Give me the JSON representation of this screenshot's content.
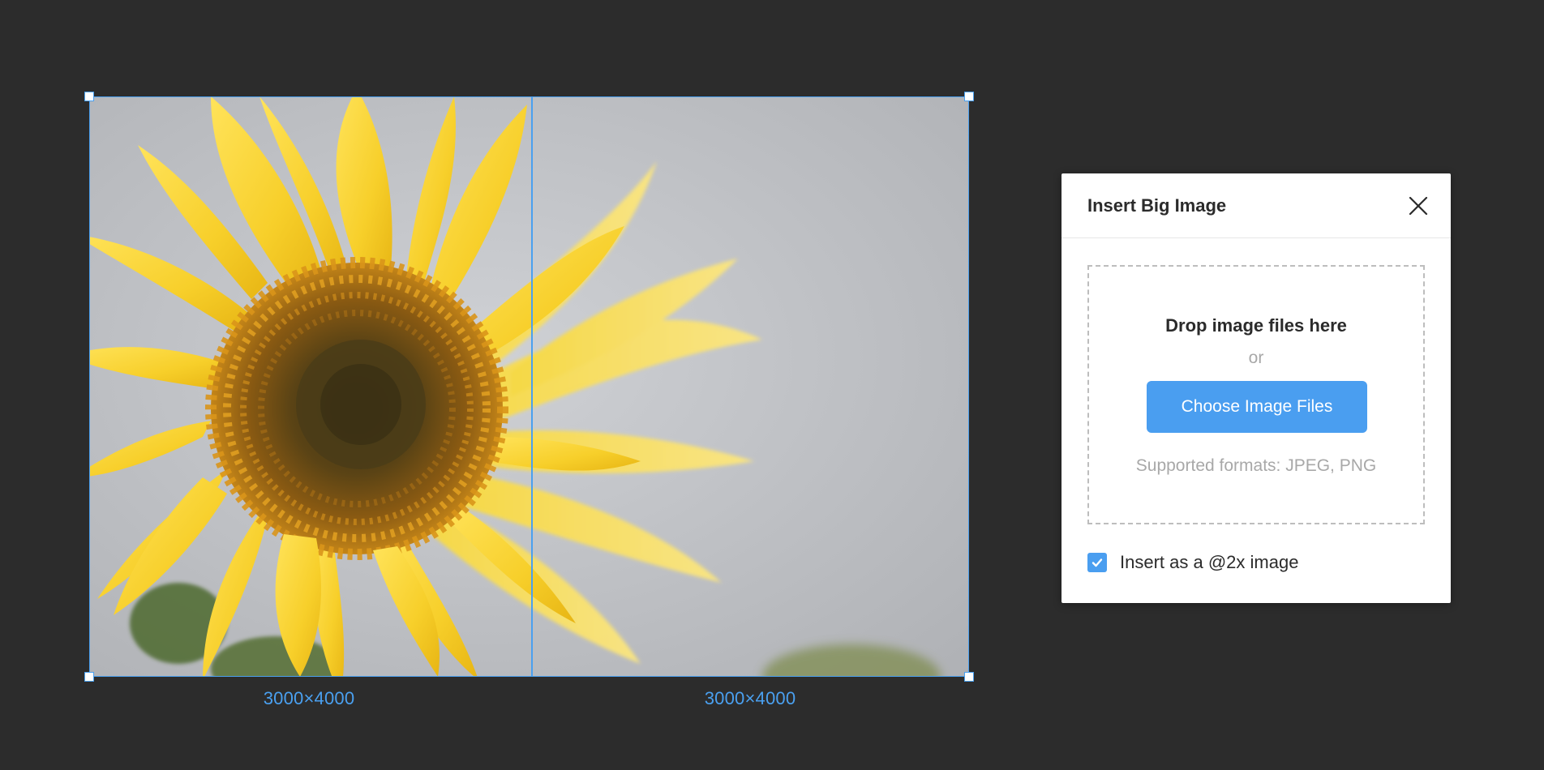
{
  "canvas": {
    "background_color": "#2c2c2c",
    "selection_color": "#4aa0f0"
  },
  "image": {
    "left_tile_label": "3000×4000",
    "right_tile_label": "3000×4000"
  },
  "dialog": {
    "title": "Insert Big Image",
    "close_icon": "close-icon",
    "dropzone": {
      "title": "Drop image files here",
      "or_text": "or",
      "button_label": "Choose Image Files",
      "formats_text": "Supported formats: JPEG, PNG"
    },
    "option": {
      "label": "Insert as a @2x image",
      "checked": true,
      "icon": "checkmark-icon"
    },
    "accent_color": "#4a9ef0"
  }
}
